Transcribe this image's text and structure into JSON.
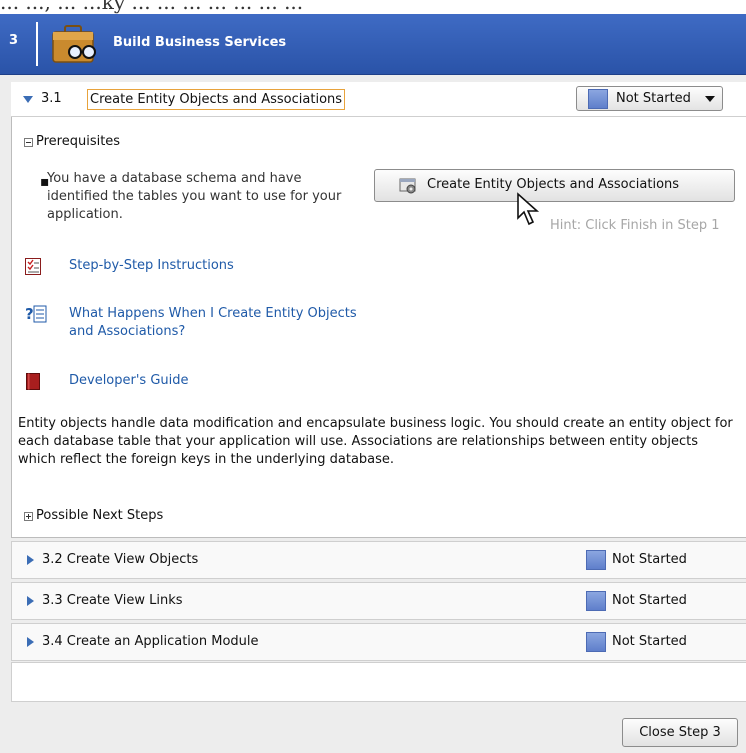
{
  "top_strip": {
    "text": "... ..., ... ...ky ... ... ... ... ... ... ..."
  },
  "header": {
    "step_number": "3",
    "title": "Build Business Services"
  },
  "open_section": {
    "number_label": "3.1",
    "title": "Create Entity Objects and Associations",
    "status": "Not Started",
    "prerequisites_label": "Prerequisites",
    "prerequisite_text": "You have a database schema and have identified the tables you want to use for your application.",
    "action_button": "Create Entity Objects and Associations",
    "hint": "Hint: Click Finish in Step 1",
    "links": [
      {
        "label": "Step-by-Step Instructions",
        "icon": "checklist-icon"
      },
      {
        "label": "What Happens When I Create Entity Objects and Associations?",
        "icon": "help-doc-icon"
      },
      {
        "label": "Developer's Guide",
        "icon": "book-icon"
      }
    ],
    "description": "Entity objects handle data modification and encapsulate business logic. You should create an entity object for each database table that your application will use. Associations are relationships between entity objects which reflect the foreign keys in the underlying database.",
    "next_steps_label": "Possible Next Steps"
  },
  "collapsed_sections": [
    {
      "label": "3.2 Create View Objects",
      "status": "Not Started"
    },
    {
      "label": "3.3 Create View Links",
      "status": "Not Started"
    },
    {
      "label": "3.4 Create an Application Module",
      "status": "Not Started"
    }
  ],
  "footer": {
    "close_button": "Close Step 3"
  },
  "colors": {
    "header_blue": "#2f5bb4",
    "link_blue": "#1f5aa8",
    "status_square": "#6f8fd6",
    "focus_outline": "#e8a33c"
  }
}
